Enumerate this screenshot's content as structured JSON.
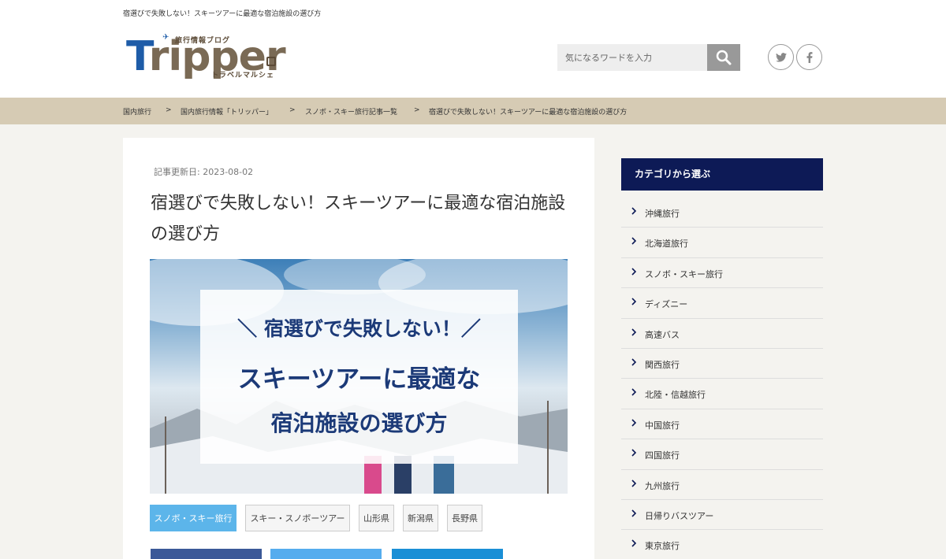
{
  "header": {
    "tagline": "宿選びで失敗しない！スキーツアーに最適な宿泊施設の選び方",
    "logo": {
      "word_first": "T",
      "word_rest": "ripper",
      "tag_top": "旅行情報ブログ",
      "tag_bottom": "トラベルマルシェ"
    },
    "search": {
      "placeholder": "気になるワードを入力"
    }
  },
  "breadcrumb": {
    "items": [
      "国内旅行",
      "国内旅行情報「トリッパー」",
      "スノボ・スキー旅行記事一覧",
      "宿選びで失敗しない！スキーツアーに最適な宿泊施設の選び方"
    ],
    "separator": ">"
  },
  "article": {
    "updated": "記事更新日: 2023-08-02",
    "title": "宿選びで失敗しない！スキーツアーに最適な宿泊施設の選び方",
    "hero": {
      "line1": "＼ 宿選びで失敗しない！／",
      "line2": "スキーツアーに最適な",
      "line3": "宿泊施設の選び方"
    },
    "tags": [
      "スノボ・スキー旅行",
      "スキー・スノボーツアー",
      "山形県",
      "新潟県",
      "長野県"
    ]
  },
  "sidebar": {
    "heading": "カテゴリから選ぶ",
    "items": [
      "沖縄旅行",
      "北海道旅行",
      "スノボ・スキー旅行",
      "ディズニー",
      "高速バス",
      "関西旅行",
      "北陸・信越旅行",
      "中国旅行",
      "四国旅行",
      "九州旅行",
      "日帰りバスツアー",
      "東京旅行"
    ]
  },
  "colors": {
    "accent_nav": "#0d1a56",
    "breadcrumb_bg": "#d6cbb4",
    "tag_primary": "#5cb5ea",
    "logo_blue": "#1e5ca8",
    "logo_brown": "#7a6a55"
  },
  "icons": [
    "search-icon",
    "twitter-icon",
    "facebook-icon",
    "chevron-right-icon"
  ]
}
